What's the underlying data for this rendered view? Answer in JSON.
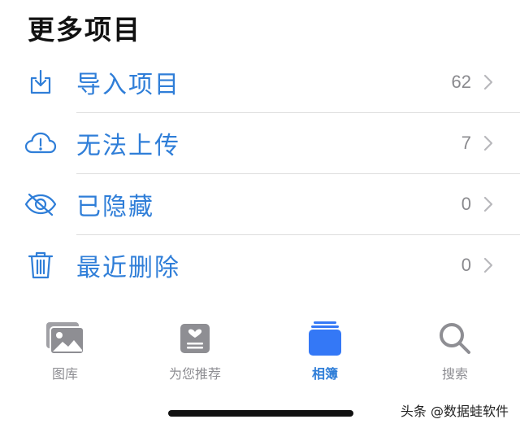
{
  "section": {
    "title": "更多项目"
  },
  "items": [
    {
      "label": "导入项目",
      "count": "62",
      "icon": "import-icon"
    },
    {
      "label": "无法上传",
      "count": "7",
      "icon": "cloud-alert-icon"
    },
    {
      "label": "已隐藏",
      "count": "0",
      "icon": "hidden-eye-icon"
    },
    {
      "label": "最近删除",
      "count": "0",
      "icon": "trash-icon"
    }
  ],
  "tabs": [
    {
      "label": "图库",
      "icon": "library-photos-icon",
      "active": false
    },
    {
      "label": "为您推荐",
      "icon": "for-you-icon",
      "active": false
    },
    {
      "label": "相簿",
      "icon": "albums-icon",
      "active": true
    },
    {
      "label": "搜索",
      "icon": "search-icon",
      "active": false
    }
  ],
  "watermark": "头条 @数据蛙软件",
  "colors": {
    "accent": "#2f7ed8",
    "inactive": "#8e8e93",
    "separator": "#dedede",
    "active_tab_icon": "#3478f6"
  }
}
